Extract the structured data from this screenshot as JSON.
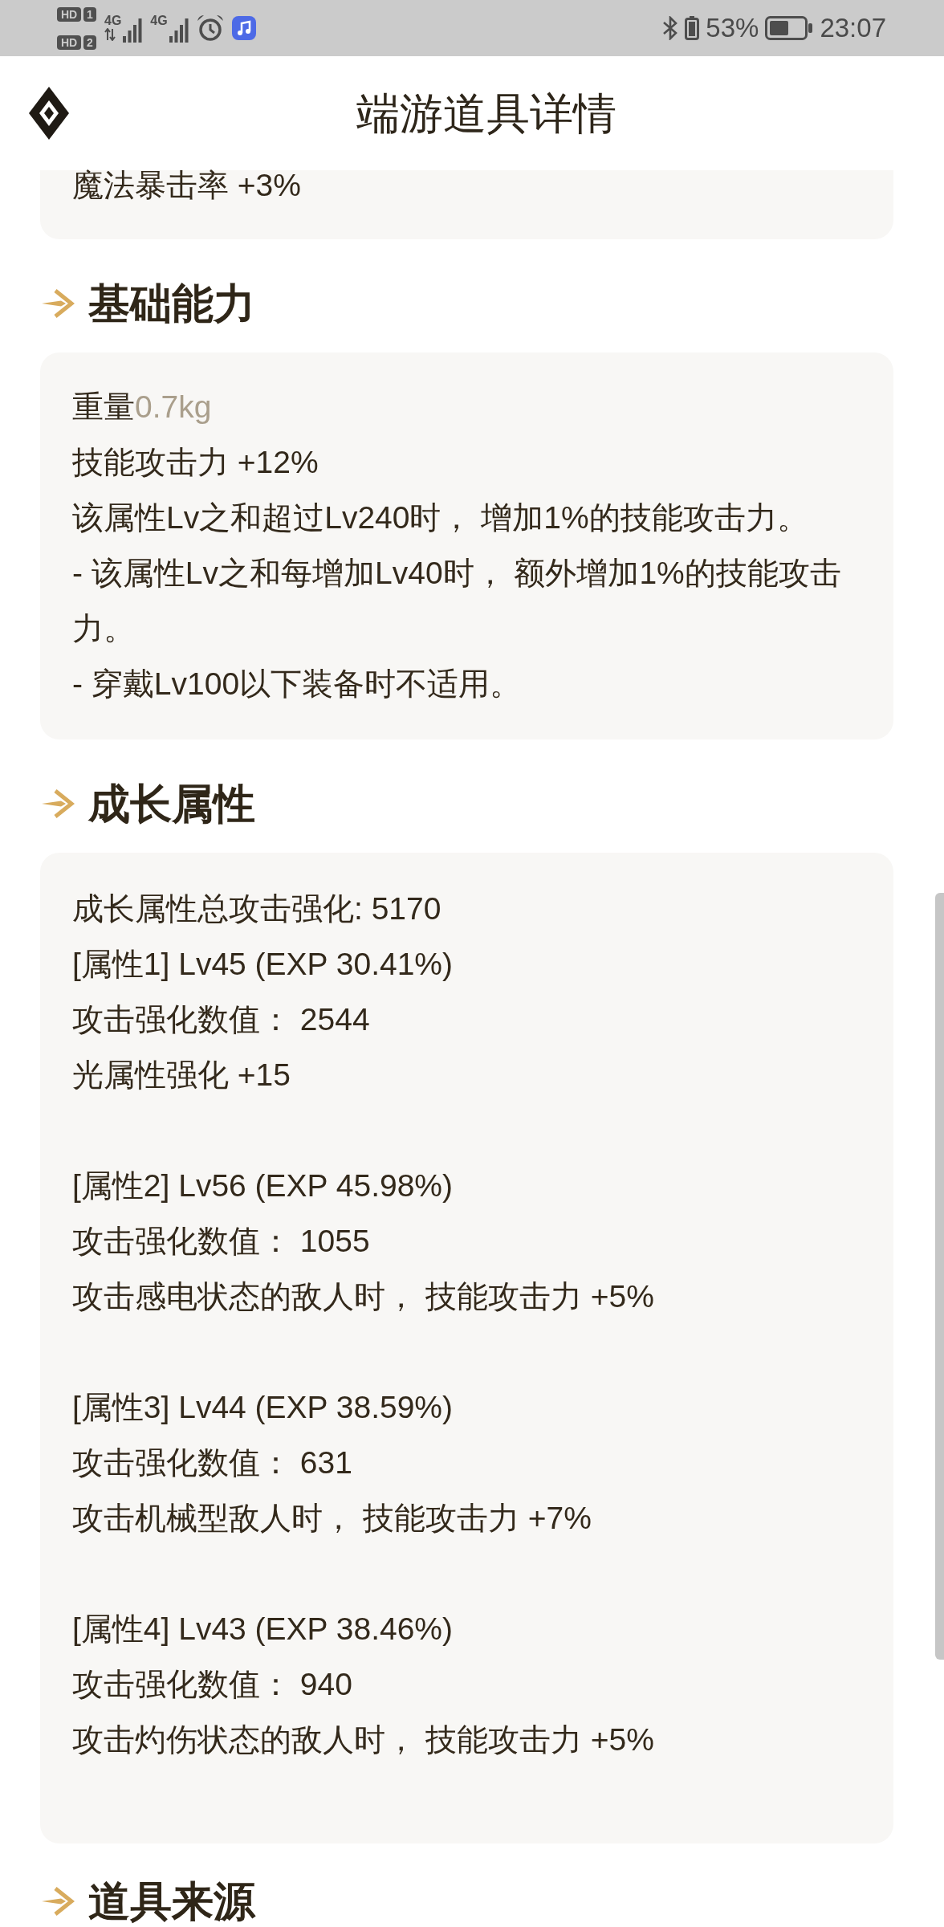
{
  "status_bar": {
    "sims": [
      {
        "badge": "HD",
        "slot": "1"
      },
      {
        "badge": "HD",
        "slot": "2"
      }
    ],
    "networks": [
      {
        "type": "4G",
        "data_active": true
      },
      {
        "type": "4G",
        "data_active": false
      }
    ],
    "battery": "53%",
    "time": "23:07"
  },
  "header": {
    "title": "端游道具详情"
  },
  "top_card": {
    "lines": [
      "魔法暴击率 +3%"
    ]
  },
  "sections": [
    {
      "kind": "plain",
      "heading": "基础能力",
      "lines": [
        {
          "kind": "weight",
          "label": "重量",
          "value": "0.7kg"
        },
        {
          "kind": "text",
          "text": "技能攻击力 +12%"
        },
        {
          "kind": "text",
          "text": "该属性Lv之和超过Lv240时， 增加1%的技能攻击力。"
        },
        {
          "kind": "text",
          "text": "- 该属性Lv之和每增加Lv40时， 额外增加1%的技能攻击力。"
        },
        {
          "kind": "text",
          "text": "- 穿戴Lv100以下装备时不适用。"
        }
      ]
    },
    {
      "kind": "growth",
      "heading": "成长属性",
      "total": "成长属性总攻击强化: 5170",
      "groups": [
        {
          "lines": [
            "[属性1] Lv45 (EXP 30.41%)",
            "攻击强化数值： 2544",
            "光属性强化 +15"
          ]
        },
        {
          "lines": [
            "[属性2] Lv56 (EXP 45.98%)",
            "攻击强化数值： 1055",
            "攻击感电状态的敌人时， 技能攻击力 +5%"
          ]
        },
        {
          "lines": [
            "[属性3] Lv44 (EXP 38.59%)",
            "攻击强化数值： 631",
            "攻击机械型敌人时， 技能攻击力 +7%"
          ]
        },
        {
          "lines": [
            "[属性4] Lv43 (EXP 38.46%)",
            "攻击强化数值： 940",
            "攻击灼伤状态的敌人时， 技能攻击力 +5%"
          ]
        }
      ]
    },
    {
      "kind": "heading_only",
      "heading": "道具来源"
    }
  ]
}
